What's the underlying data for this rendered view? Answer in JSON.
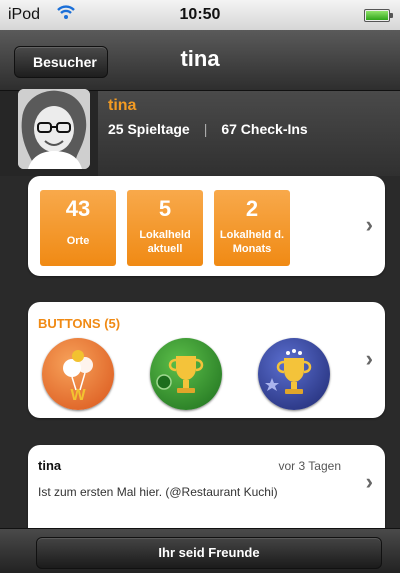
{
  "status_bar": {
    "carrier": "iPod",
    "time": "10:50"
  },
  "nav": {
    "back_label": "Besucher",
    "title": "tina"
  },
  "profile": {
    "name": "tina",
    "play_days": "25 Spieltage",
    "separator": "|",
    "checkins": "67 Check-Ins"
  },
  "stats": [
    {
      "value": "43",
      "label": "Orte"
    },
    {
      "value": "5",
      "label": "Lokalheld aktuell"
    },
    {
      "value": "2",
      "label": "Lokalheld d. Monats"
    }
  ],
  "badges": {
    "title": "BUTTONS (5)",
    "items": [
      {
        "icon": "balloons-w-badge-icon",
        "color": "#e8661c"
      },
      {
        "icon": "trophy-green-badge-icon",
        "color": "#2a8a2a"
      },
      {
        "icon": "trophy-blue-badge-icon",
        "color": "#2e3c8c"
      }
    ]
  },
  "feed": {
    "user": "tina",
    "time": "vor 3 Tagen",
    "text": "Ist zum ersten Mal hier. (@Restaurant Kuchi)"
  },
  "toolbar": {
    "friends_label": "Ihr seid Freunde"
  }
}
